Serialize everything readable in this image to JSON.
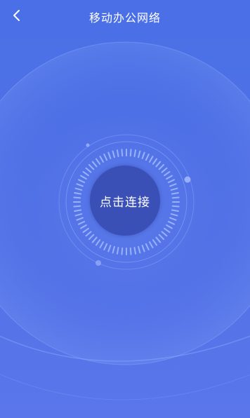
{
  "header": {
    "title": "移动办公网络",
    "back_icon": "chevron-left-icon"
  },
  "main": {
    "connect_button_label": "点击连接"
  },
  "colors": {
    "background_top": "#4a6fe6",
    "background_bottom": "#5a76ea",
    "button_fill": "#3a50b6",
    "text": "#ffffff"
  }
}
